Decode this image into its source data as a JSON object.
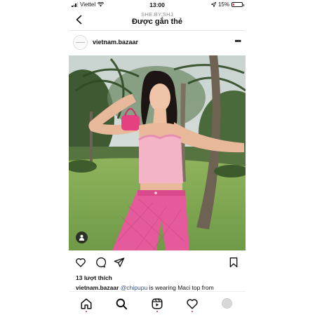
{
  "status_bar": {
    "carrier": "Viettel",
    "time": "13:00",
    "battery": "15%",
    "battery_level": 0.15,
    "icons": [
      "signal-icon",
      "wifi-icon",
      "location-arrow-icon",
      "battery-icon"
    ]
  },
  "nav": {
    "subtitle": "SHE.BY.SHJ",
    "title": "Được gắn thẻ",
    "back_icon": "chevron-left-icon"
  },
  "post": {
    "username": "vietnam.bazaar",
    "more_icon": "more-dots-icon",
    "likes": "13 lượt thích",
    "caption_username": "vietnam.bazaar",
    "caption_mention": "@chipupu",
    "caption_text": " is wearing Maci top from",
    "tag_icon": "user-tag-icon"
  },
  "action_icons": [
    "heart-icon",
    "comment-icon",
    "share-icon",
    "bookmark-icon"
  ],
  "tabbar": {
    "icons": [
      "home-icon",
      "search-icon",
      "reels-icon",
      "activity-heart-icon",
      "profile-avatar"
    ],
    "notification_color": "#e0245e"
  },
  "colors": {
    "mention": "#385185",
    "battery_low": "#e0312d",
    "top_pink": "#f3b4c8",
    "pants_pink": "#e45a9b",
    "grass": "#7fa451"
  }
}
